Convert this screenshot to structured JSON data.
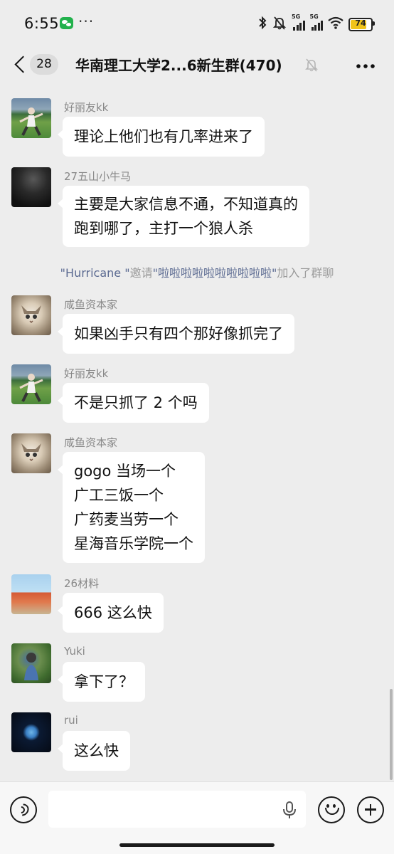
{
  "status_bar": {
    "time": "6:55",
    "dots": "···",
    "bluetooth_icon": "bluetooth-icon",
    "mute_icon": "bell-off-icon",
    "signal_1_label": "5G",
    "signal_2_label": "5G",
    "battery_level": "74",
    "battery_fraction": 0.74,
    "battery_color": "#F0C419"
  },
  "header": {
    "unread_count": "28",
    "title": "华南理工大学2...6新生群(470)",
    "back_icon": "chevron-left-icon",
    "mute_icon": "bell-off-icon",
    "more_icon": "more-horizontal-icon"
  },
  "messages": [
    {
      "sender": "好丽友kk",
      "avatar": "soccer-player-avatar",
      "lines": [
        "理论上他们也有几率进来了"
      ]
    },
    {
      "sender": "27五山小牛马",
      "avatar": "dark-photo-avatar",
      "lines": [
        "主要是大家信息不通，不知道真的",
        "跑到哪了，主打一个狼人杀"
      ]
    },
    {
      "sender": "咸鱼资本家",
      "avatar": "cat-avatar",
      "lines": [
        "如果凶手只有四个那好像抓完了"
      ]
    },
    {
      "sender": "好丽友kk",
      "avatar": "soccer-player-avatar",
      "lines": [
        "不是只抓了 2 个吗"
      ]
    },
    {
      "sender": "咸鱼资本家",
      "avatar": "cat-avatar",
      "lines": [
        "gogo 当场一个",
        "广工三饭一个",
        "广药麦当劳一个",
        "星海音乐学院一个"
      ]
    },
    {
      "sender": "26材料",
      "avatar": "building-avatar",
      "lines": [
        "666 这么快"
      ]
    },
    {
      "sender": "Yuki",
      "avatar": "person-avatar",
      "lines": [
        "拿下了？"
      ]
    },
    {
      "sender": "rui",
      "avatar": "earth-avatar",
      "lines": [
        "这么快"
      ]
    }
  ],
  "system_notice": {
    "inviter": "\"Hurricane \"",
    "verb": "邀请",
    "invitee": "\"啦啦啦啦啦啦啦啦啦啦\"",
    "suffix": "加入了群聊"
  },
  "input_bar": {
    "placeholder": "",
    "voice_icon": "voice-icon",
    "mic_icon": "microphone-icon",
    "emoji_icon": "emoji-icon",
    "plus_icon": "plus-icon"
  },
  "colors": {
    "background": "#EDEDED",
    "bubble": "#FFFFFF",
    "sender_name": "#888888",
    "system_text": "#9A9A9A",
    "system_name": "#5B6A91"
  }
}
